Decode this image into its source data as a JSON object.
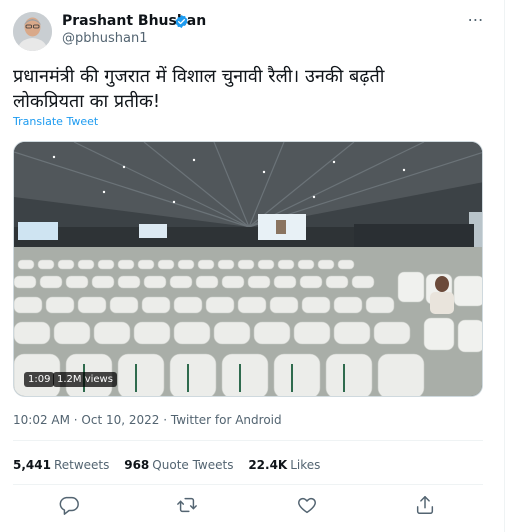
{
  "author": {
    "name": "Prashant Bhushan",
    "handle": "@pbhushan1",
    "verified_color": "#1d9bf0"
  },
  "more_icon": "⋯",
  "tweet": {
    "text_line1": "प्रधानमंत्री की गुजरात में विशाल चुनावी रैली। उनकी बढ़ती",
    "text_line2": "लोकप्रियता का प्रतीक!",
    "translate_label": "Translate Tweet"
  },
  "media": {
    "type": "video",
    "duration": "1:09",
    "views": "1.2M views"
  },
  "meta": {
    "time": "10:02 AM",
    "separator1": " · ",
    "date": "Oct 10, 2022",
    "separator2": " · ",
    "source": "Twitter for Android"
  },
  "stats": {
    "retweets_count": "5,441",
    "retweets_label": "Retweets",
    "quotes_count": "968",
    "quotes_label": "Quote Tweets",
    "likes_count": "22.4K",
    "likes_label": "Likes"
  },
  "actions": [
    "reply-icon",
    "retweet-icon",
    "like-icon",
    "share-icon"
  ],
  "colors": {
    "text": "#0f1419",
    "secondary": "#536471",
    "link": "#1d9bf0",
    "border": "#eff3f4"
  }
}
